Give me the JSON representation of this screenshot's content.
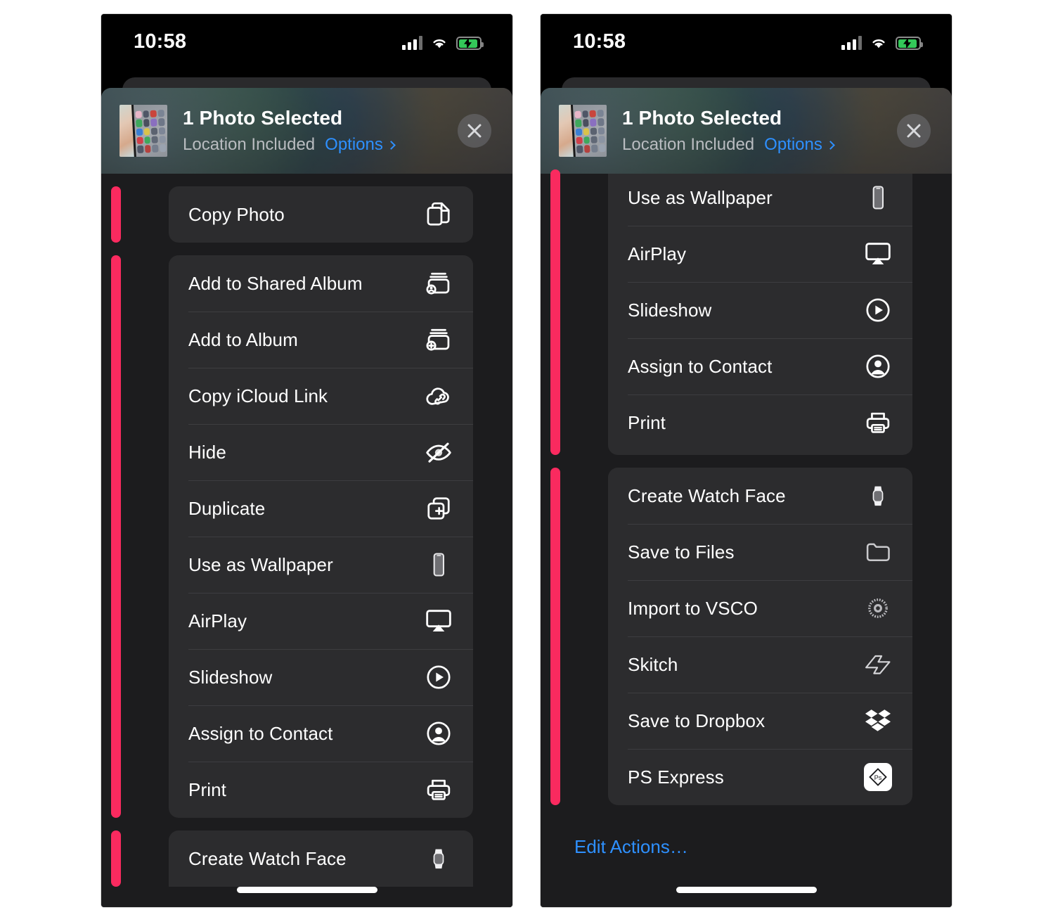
{
  "status_bar": {
    "time": "10:58",
    "icons": [
      "cellular-signal-icon",
      "wifi-icon",
      "battery-charging-icon"
    ]
  },
  "share_sheet_header": {
    "title": "1 Photo Selected",
    "subtitle": "Location Included",
    "options_label": "Options",
    "close_label": "✕",
    "thumbnail_name": "photo-thumbnail",
    "accent_link_color": "#2e90ff"
  },
  "annotation": {
    "highlight_color": "#fa2a5f",
    "name": "pink-highlight-bar"
  },
  "edit_actions_label": "Edit Actions…",
  "left_panel": {
    "groups": [
      {
        "id": "group-copy",
        "clip": "none",
        "rows": [
          {
            "label": "Copy Photo",
            "icon": "copy-photo-icon"
          }
        ]
      },
      {
        "id": "group-album-actions",
        "clip": "none",
        "rows": [
          {
            "label": "Add to Shared Album",
            "icon": "add-to-shared-album-icon"
          },
          {
            "label": "Add to Album",
            "icon": "add-to-album-icon"
          },
          {
            "label": "Copy iCloud Link",
            "icon": "cloud-link-icon"
          },
          {
            "label": "Hide",
            "icon": "eye-slash-icon"
          },
          {
            "label": "Duplicate",
            "icon": "duplicate-icon"
          },
          {
            "label": "Use as Wallpaper",
            "icon": "iphone-icon"
          },
          {
            "label": "AirPlay",
            "icon": "airplay-icon"
          },
          {
            "label": "Slideshow",
            "icon": "play-circle-icon"
          },
          {
            "label": "Assign to Contact",
            "icon": "person-circle-icon"
          },
          {
            "label": "Print",
            "icon": "printer-icon"
          }
        ]
      },
      {
        "id": "group-apps",
        "clip": "bottom",
        "rows": [
          {
            "label": "Create Watch Face",
            "icon": "apple-watch-icon"
          }
        ]
      }
    ]
  },
  "right_panel": {
    "groups": [
      {
        "id": "group-system-actions",
        "clip": "top",
        "rows": [
          {
            "label": "Use as Wallpaper",
            "icon": "iphone-icon"
          },
          {
            "label": "AirPlay",
            "icon": "airplay-icon"
          },
          {
            "label": "Slideshow",
            "icon": "play-circle-icon"
          },
          {
            "label": "Assign to Contact",
            "icon": "person-circle-icon"
          },
          {
            "label": "Print",
            "icon": "printer-icon"
          }
        ]
      },
      {
        "id": "group-app-actions",
        "clip": "none",
        "rows": [
          {
            "label": "Create Watch Face",
            "icon": "apple-watch-icon"
          },
          {
            "label": "Save to Files",
            "icon": "folder-icon"
          },
          {
            "label": "Import to VSCO",
            "icon": "vsco-icon"
          },
          {
            "label": "Skitch",
            "icon": "skitch-icon"
          },
          {
            "label": "Save to Dropbox",
            "icon": "dropbox-icon"
          },
          {
            "label": "PS Express",
            "icon": "ps-express-icon"
          }
        ]
      }
    ],
    "show_edit_actions": true
  }
}
